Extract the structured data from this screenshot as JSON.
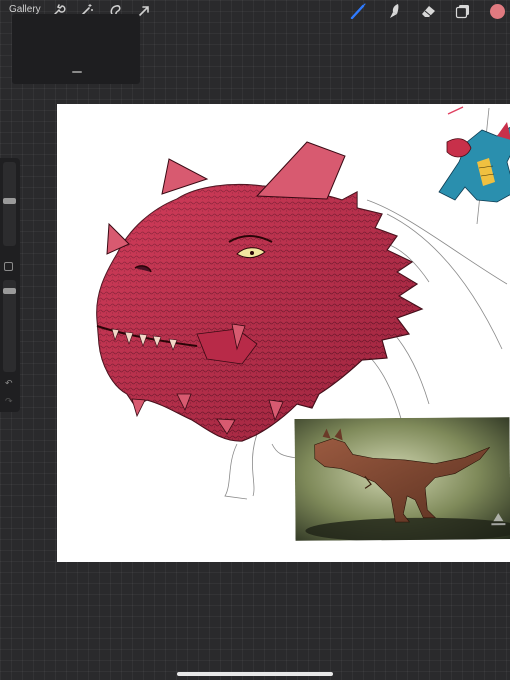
{
  "topbar": {
    "gallery_label": "Gallery",
    "left_tools": [
      "wrench-icon",
      "magic-wand-icon",
      "selection-icon",
      "transform-arrow-icon"
    ],
    "right_tools": [
      "brush-icon",
      "smudge-icon",
      "eraser-icon",
      "layers-icon"
    ],
    "active_tool": "brush-icon",
    "active_color": "#e07a80",
    "accent_color": "#2f7bff"
  },
  "sidebar": {
    "controls": [
      "brush-size-slider",
      "modify-button",
      "opacity-slider",
      "undo-icon",
      "redo-icon"
    ],
    "undo_glyph": "↶",
    "redo_glyph": "↷"
  },
  "canvas": {
    "background": "#ffffff",
    "artwork": "red-dragon-head-drawing",
    "reference_images": [
      "small-blue-dragon-reference",
      "carnotaurus-photo-reference"
    ]
  }
}
